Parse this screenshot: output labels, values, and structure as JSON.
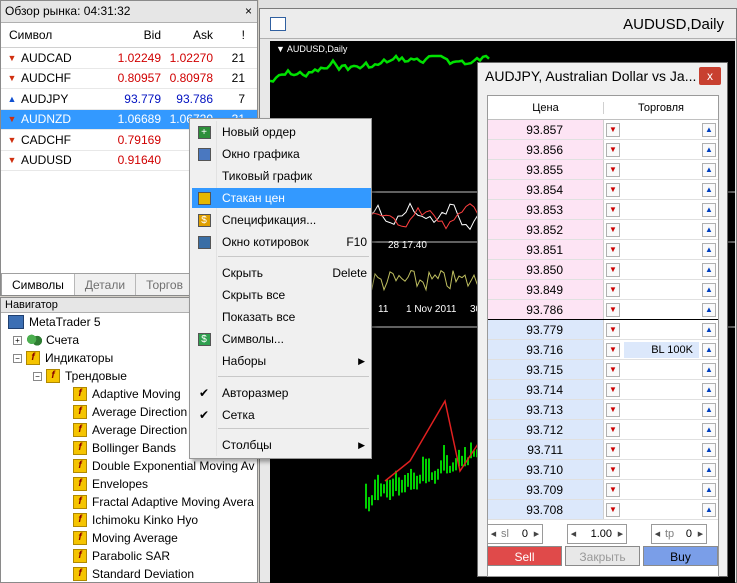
{
  "market_watch": {
    "title": "Обзор рынка: 04:31:32",
    "close_glyph": "×",
    "columns": {
      "symbol": "Символ",
      "bid": "Bid",
      "ask": "Ask",
      "spread": "!"
    },
    "rows": [
      {
        "symbol": "AUDCAD",
        "bid": "1.02249",
        "ask": "1.02270",
        "spread": "21",
        "dir": "down"
      },
      {
        "symbol": "AUDCHF",
        "bid": "0.80957",
        "ask": "0.80978",
        "spread": "21",
        "dir": "down"
      },
      {
        "symbol": "AUDJPY",
        "bid": "93.779",
        "ask": "93.786",
        "spread": "7",
        "dir": "up"
      },
      {
        "symbol": "AUDNZD",
        "bid": "1.06689",
        "ask": "1.06720",
        "spread": "31",
        "dir": "down"
      },
      {
        "symbol": "CADCHF",
        "bid": "0.79169",
        "ask": "0.7",
        "spread": "",
        "dir": "down"
      },
      {
        "symbol": "AUDUSD",
        "bid": "0.91640",
        "ask": "0.9",
        "spread": "",
        "dir": "down"
      }
    ],
    "tabs": [
      "Символы",
      "Детали",
      "Торгов"
    ]
  },
  "navigator": {
    "title": "Навигатор",
    "items": {
      "root": "MetaTrader 5",
      "accounts": "Счета",
      "indicators": "Индикаторы",
      "trend": "Трендовые",
      "list": [
        "Adaptive Moving",
        "Average Direction",
        "Average Direction",
        "Bollinger Bands",
        "Double Exponential Moving Av",
        "Envelopes",
        "Fractal Adaptive Moving Avera",
        "Ichimoku Kinko Hyo",
        "Moving Average",
        "Parabolic SAR",
        "Standard Deviation"
      ]
    }
  },
  "chart": {
    "title": "AUDUSD,Daily",
    "symbol_label": "▼ AUDUSD,Daily",
    "indicator_label": "28 17.40",
    "axis_labels": [
      "11",
      "1 Nov 2011",
      "30"
    ]
  },
  "context_menu": {
    "items": [
      {
        "label": "Новый ордер",
        "shortcut": ""
      },
      {
        "label": "Окно графика",
        "shortcut": ""
      },
      {
        "label": "Тиковый график",
        "shortcut": ""
      },
      {
        "label": "Стакан цен",
        "shortcut": ""
      },
      {
        "label": "Спецификация...",
        "shortcut": ""
      },
      {
        "label": "Окно котировок",
        "shortcut": "F10"
      },
      {
        "label": "Скрыть",
        "shortcut": "Delete"
      },
      {
        "label": "Скрыть все",
        "shortcut": ""
      },
      {
        "label": "Показать все",
        "shortcut": ""
      },
      {
        "label": "Символы...",
        "shortcut": ""
      },
      {
        "label": "Наборы",
        "shortcut": "▶"
      },
      {
        "label": "Авторазмер",
        "shortcut": ""
      },
      {
        "label": "Сетка",
        "shortcut": ""
      },
      {
        "label": "Столбцы",
        "shortcut": "▶"
      }
    ],
    "check_glyph": "✔"
  },
  "depth_of_market": {
    "title": "AUDJPY, Australian Dollar vs Ja...",
    "close_glyph": "x",
    "columns": {
      "price": "Цена",
      "trade": "Торговля"
    },
    "ask_prices": [
      "93.857",
      "93.856",
      "93.855",
      "93.854",
      "93.853",
      "93.852",
      "93.851",
      "93.850",
      "93.849",
      "93.786"
    ],
    "bid_prices": [
      "93.779",
      "93.716",
      "93.715",
      "93.714",
      "93.713",
      "93.712",
      "93.711",
      "93.710",
      "93.709",
      "93.708"
    ],
    "bid_volume_label": "BL 100K",
    "sl": {
      "label": "sl",
      "value": "0"
    },
    "volume": {
      "value": "1.00"
    },
    "tp": {
      "label": "tp",
      "value": "0"
    },
    "buttons": {
      "sell": "Sell",
      "close": "Закрыть",
      "buy": "Buy"
    }
  }
}
